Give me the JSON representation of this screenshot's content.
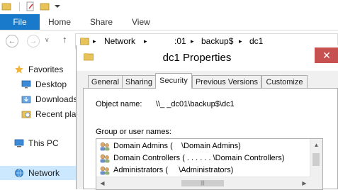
{
  "ribbon": {
    "file": "File",
    "home": "Home",
    "share": "Share",
    "view": "View"
  },
  "navbar": {
    "back_icon": "←",
    "forward_icon": "→",
    "recent_icon": "v",
    "up_icon": "↑",
    "breadcrumb": [
      "Network",
      ":01",
      "backup$",
      "dc1"
    ],
    "sep": "▸"
  },
  "navpane": {
    "items": [
      {
        "label": "Favorites"
      },
      {
        "label": "Desktop"
      },
      {
        "label": "Downloads"
      },
      {
        "label": "Recent plac"
      },
      {
        "label": "This PC"
      },
      {
        "label": "Network"
      }
    ]
  },
  "dialog": {
    "title": "dc1 Properties",
    "close": "✕",
    "tabs": [
      "General",
      "Sharing",
      "Security",
      "Previous Versions",
      "Customize"
    ],
    "object_label": "Object name:",
    "object_value": "\\\\_  _dc01\\backup$\\dc1",
    "group_label": "Group or user names:",
    "users": [
      "Domain Admins (    \\Domain Admins)",
      "Domain Controllers ( . . . . . . \\Domain Controllers)",
      "Administrators (     \\Administrators)"
    ],
    "scroll_up": "▲",
    "scroll_left": "◀",
    "scroll_right": "▶",
    "grip": "|||"
  },
  "colors": {
    "accent": "#1979ca",
    "close_red": "#c75050",
    "selection": "#cce8ff"
  }
}
